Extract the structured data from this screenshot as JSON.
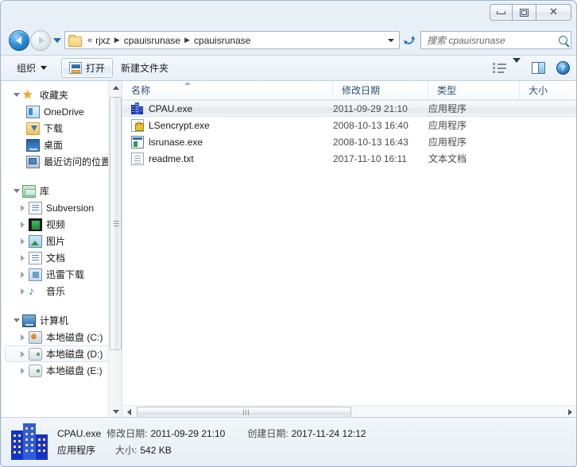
{
  "window": {
    "controls": {
      "minimize": "minimize-button",
      "maximize": "restore-button",
      "close": "close-button",
      "close_glyph": "✕"
    }
  },
  "address_bar": {
    "back_tooltip": "后退",
    "forward_tooltip": "前进",
    "crumb_chevron": "«",
    "separator": "▶",
    "path": [
      "rjxz",
      "cpauisrunase",
      "cpauisrunase"
    ],
    "refresh_glyph": "↻"
  },
  "search": {
    "placeholder": "搜索 cpauisrunase"
  },
  "toolbar": {
    "organize_label": "组织",
    "open_label": "打开",
    "new_folder_label": "新建文件夹",
    "views_icon": "view-options-icon",
    "preview_icon": "preview-pane-icon",
    "help_icon": "help-icon",
    "help_glyph": "?"
  },
  "nav_pane": {
    "groups": [
      {
        "name": "收藏夹",
        "icon": "star-icon",
        "expanded": true,
        "items": [
          {
            "label": "OneDrive",
            "icon": "onedrive-icon",
            "expandable": false
          },
          {
            "label": "下载",
            "icon": "downloads-icon",
            "expandable": false
          },
          {
            "label": "桌面",
            "icon": "desktop-icon",
            "expandable": false
          },
          {
            "label": "最近访问的位置",
            "icon": "recent-places-icon",
            "expandable": false
          }
        ]
      },
      {
        "name": "库",
        "icon": "library-icon",
        "expanded": true,
        "items": [
          {
            "label": "Subversion",
            "icon": "subversion-icon",
            "expandable": true
          },
          {
            "label": "视频",
            "icon": "videos-icon",
            "expandable": true
          },
          {
            "label": "图片",
            "icon": "pictures-icon",
            "expandable": true
          },
          {
            "label": "文档",
            "icon": "documents-icon",
            "expandable": true
          },
          {
            "label": "迅雷下载",
            "icon": "thunder-download-icon",
            "expandable": true
          },
          {
            "label": "音乐",
            "icon": "music-icon",
            "expandable": true
          }
        ]
      },
      {
        "name": "计算机",
        "icon": "computer-icon",
        "expanded": true,
        "items": [
          {
            "label": "本地磁盘 (C:)",
            "icon": "system-drive-icon",
            "expandable": true,
            "selected": false
          },
          {
            "label": "本地磁盘 (D:)",
            "icon": "drive-icon",
            "expandable": true,
            "selected": true
          },
          {
            "label": "本地磁盘 (E:)",
            "icon": "drive-icon",
            "expandable": true,
            "selected": false
          }
        ]
      }
    ]
  },
  "file_list": {
    "columns": [
      "名称",
      "修改日期",
      "类型",
      "大小"
    ],
    "sort_column": "名称",
    "sort_direction": "ascending",
    "rows": [
      {
        "name": "CPAU.exe",
        "modified": "2011-09-29 21:10",
        "type": "应用程序",
        "size": "",
        "icon": "cpau-buildings-icon",
        "selected": true
      },
      {
        "name": "LSencrypt.exe",
        "modified": "2008-10-13 16:40",
        "type": "应用程序",
        "size": "",
        "icon": "padlock-document-icon",
        "selected": false
      },
      {
        "name": "lsrunase.exe",
        "modified": "2008-10-13 16:43",
        "type": "应用程序",
        "size": "",
        "icon": "application-window-icon",
        "selected": false
      },
      {
        "name": "readme.txt",
        "modified": "2017-11-10 16:11",
        "type": "文本文档",
        "size": "",
        "icon": "text-document-icon",
        "selected": false
      }
    ]
  },
  "details_pane": {
    "icon": "cpau-buildings-icon",
    "file_name": "CPAU.exe",
    "modified_label": "修改日期:",
    "modified_value": "2011-09-29 21:10",
    "created_label": "创建日期:",
    "created_value": "2017-11-24 12:12",
    "type_value": "应用程序",
    "size_label": "大小:",
    "size_value": "542 KB"
  },
  "colors": {
    "column_header_text": "#2d5277",
    "accent_blue": "#1f6fb5",
    "window_bg": "#e9f0f7"
  }
}
